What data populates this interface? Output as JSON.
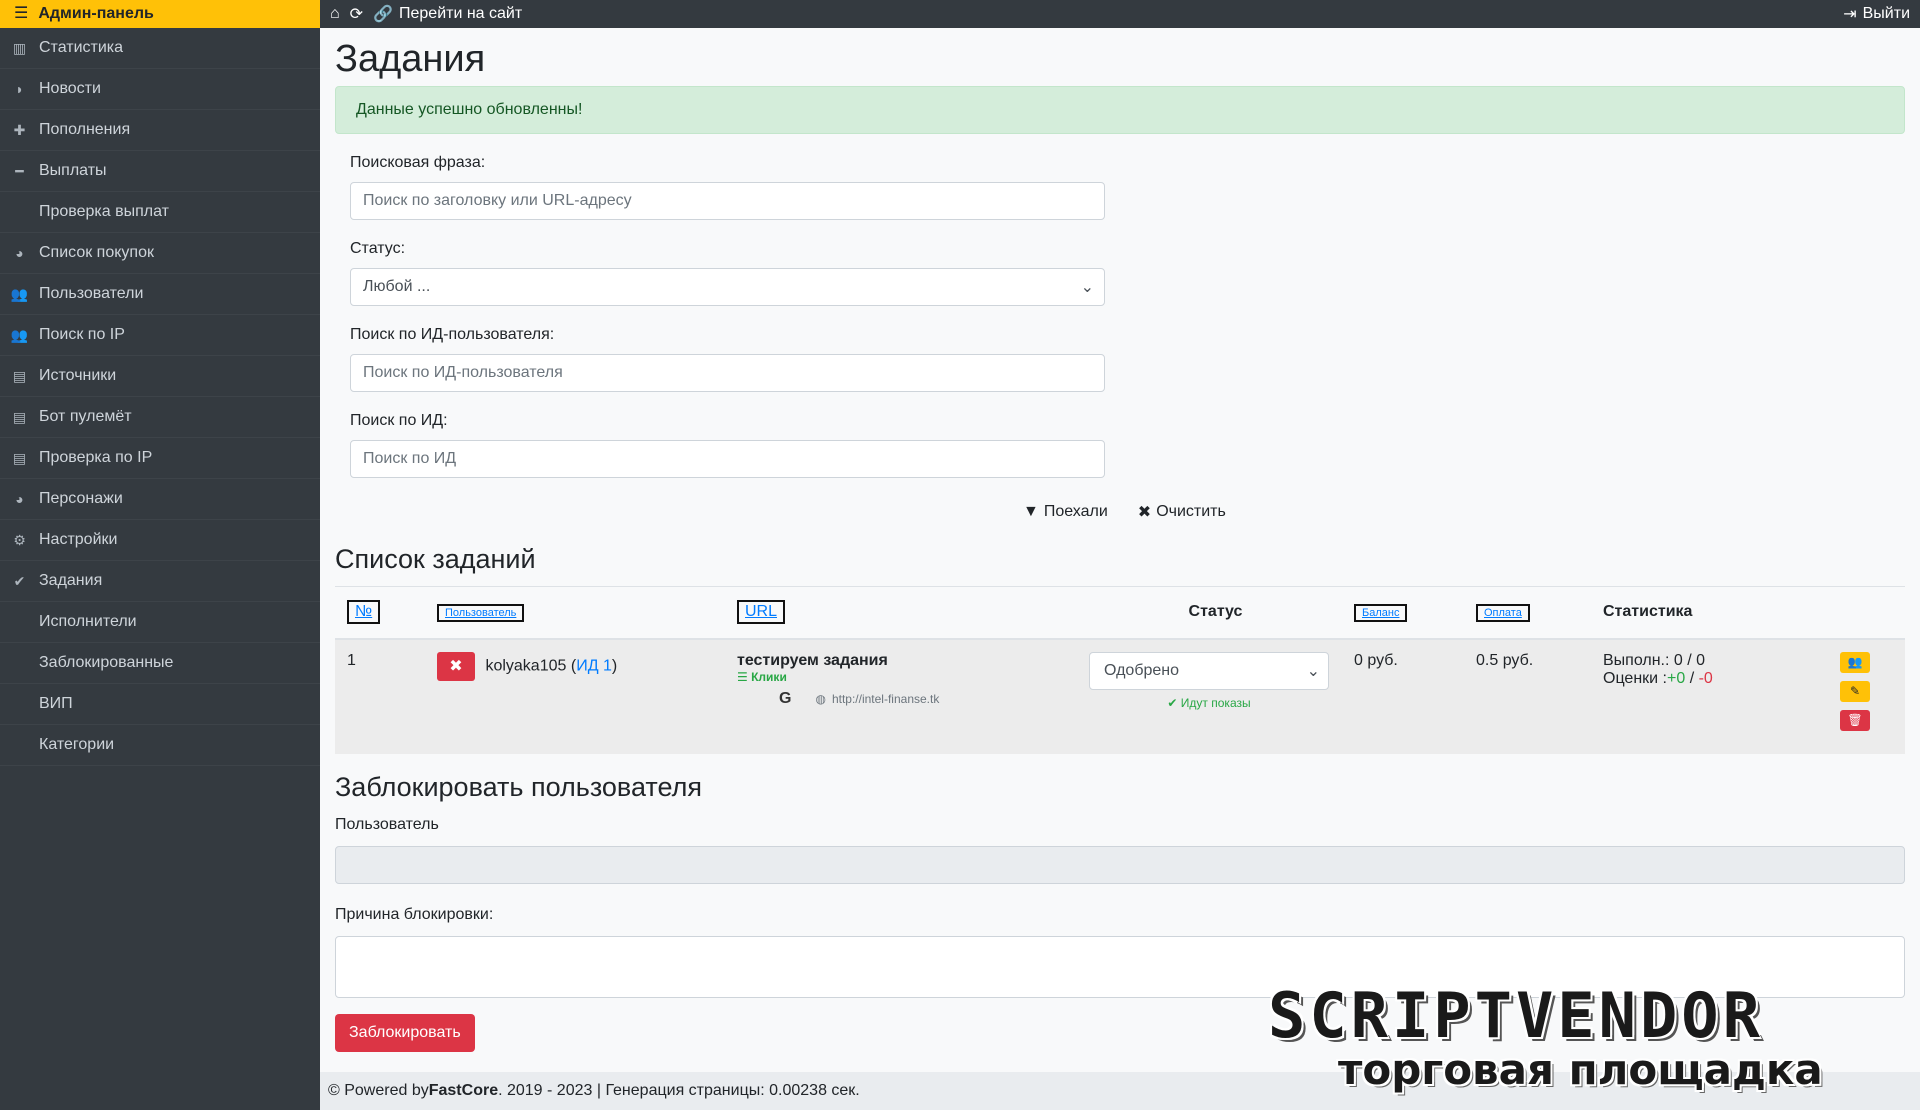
{
  "sidebar": {
    "brand": "Админ-панель",
    "items": [
      {
        "label": "Статистика",
        "icon": "bar-chart-icon"
      },
      {
        "label": "Новости",
        "icon": "rss-icon"
      },
      {
        "label": "Пополнения",
        "icon": "plus-icon"
      },
      {
        "label": "Выплаты",
        "icon": "minus-icon"
      },
      {
        "label": "Проверка выплат",
        "icon": ""
      },
      {
        "label": "Список покупок",
        "icon": "pie-icon"
      },
      {
        "label": "Пользователи",
        "icon": "users-icon"
      },
      {
        "label": "Поиск по IP",
        "icon": "users-icon"
      },
      {
        "label": "Источники",
        "icon": "map-icon"
      },
      {
        "label": "Бот пулемёт",
        "icon": "map-icon"
      },
      {
        "label": "Проверка по IP",
        "icon": "map-icon"
      },
      {
        "label": "Персонажи",
        "icon": "pie-icon"
      },
      {
        "label": "Настройки",
        "icon": "gear-icon"
      },
      {
        "label": "Задания",
        "icon": "check-icon"
      },
      {
        "label": "Исполнители",
        "icon": ""
      },
      {
        "label": "Заблокированные",
        "icon": ""
      },
      {
        "label": "ВИП",
        "icon": ""
      },
      {
        "label": "Категории",
        "icon": ""
      }
    ]
  },
  "topbar": {
    "site_link": "Перейти на сайт",
    "logout": "Выйти"
  },
  "page": {
    "title": "Задания",
    "alert": "Данные успешно обновленны!"
  },
  "filter": {
    "search_label": "Поисковая фраза:",
    "search_placeholder": "Поиск по заголовку или URL-адресу",
    "status_label": "Статус:",
    "status_value": "Любой ...",
    "user_label": "Поиск по ИД-пользователя:",
    "user_placeholder": "Поиск по ИД-пользователя",
    "id_label": "Поиск по ИД:",
    "id_placeholder": "Поиск по ИД",
    "go": "Поехали",
    "clear": "Очистить"
  },
  "tasks": {
    "title": "Список заданий",
    "columns": {
      "num": "№",
      "user": "Пользователь",
      "url": "URL",
      "status": "Статус",
      "balance": "Баланс",
      "payment": "Оплата",
      "stats": "Статистика"
    },
    "rows": [
      {
        "num": "1",
        "username": "kolyaka105",
        "user_id_link": "ИД 1",
        "task_title": "тестируем задания",
        "task_type": "Клики",
        "task_url": "http://intel-finanse.tk",
        "status": "Одобрено",
        "status_note": "Идут показы",
        "balance": "0 руб.",
        "payment": "0.5 руб.",
        "done": "Выполн.: 0 / 0",
        "ratings_label": "Оценки :",
        "ratings_plus": "+0",
        "ratings_sep": " / ",
        "ratings_minus": "-0"
      }
    ]
  },
  "block": {
    "title": "Заблокировать пользователя",
    "user_label": "Пользователь",
    "reason_label": "Причина блокировки:",
    "button": "Заблокировать"
  },
  "footer": {
    "prefix": "© Powered by ",
    "brand": "FastCore",
    "suffix": ". 2019 - 2023 | Генерация страницы: 0.00238 сек."
  },
  "watermark": {
    "line1": "SCRIPTVENDOR",
    "line2": "торговая площадка"
  }
}
